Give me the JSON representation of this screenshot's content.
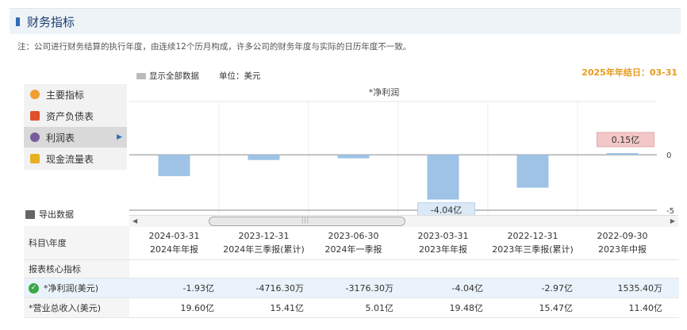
{
  "page": {
    "title": "财务指标",
    "note": "注：公司进行财务结算的执行年度，由连续12个历月构成，许多公司的财务年度与实际的日历年度不一致。",
    "fiscal_year_end": "2025年年结日：03-31",
    "show_all_label": "显示全部数据",
    "unit_label": "单位：美元",
    "export_label": "导出数据"
  },
  "nav": {
    "items": [
      {
        "label": "主要指标",
        "icon": "main-indicator-icon",
        "color": "#f0a030"
      },
      {
        "label": "资产负债表",
        "icon": "balance-sheet-icon",
        "color": "#e0502a"
      },
      {
        "label": "利润表",
        "icon": "income-statement-icon",
        "color": "#7a5c9c"
      },
      {
        "label": "现金流量表",
        "icon": "cash-flow-icon",
        "color": "#e8b020"
      }
    ],
    "active_index": 2
  },
  "chart_data": {
    "type": "bar",
    "title": "*净利润",
    "unit": "亿",
    "categories": [
      "2024-03-31",
      "2023-12-31",
      "2023-06-30",
      "2023-03-31",
      "2022-12-31",
      "2022-09-30"
    ],
    "values": [
      -1.93,
      -0.47163,
      -0.31763,
      -4.04,
      -2.97,
      0.15354
    ],
    "ylim": [
      -5.5,
      4.8
    ],
    "yticks": [
      "0",
      "-5"
    ],
    "bar_color": "#9ec3e6",
    "annotations": [
      {
        "category": "2023-03-31",
        "label": "-4.04亿"
      },
      {
        "category": "2022-09-30",
        "label": "0.15亿"
      }
    ],
    "grid": true
  },
  "table": {
    "corner_label": "科目\\年度",
    "columns": [
      {
        "date": "2024-03-31",
        "period": "2024年年报"
      },
      {
        "date": "2023-12-31",
        "period": "2024年三季报(累计)"
      },
      {
        "date": "2023-06-30",
        "period": "2024年一季报"
      },
      {
        "date": "2023-03-31",
        "period": "2023年年报"
      },
      {
        "date": "2022-12-31",
        "period": "2023年三季报(累计)"
      },
      {
        "date": "2022-09-30",
        "period": "2023年中报"
      }
    ],
    "section_label": "报表核心指标",
    "rows": [
      {
        "label": "*净利润(美元)",
        "checked": true,
        "values": [
          "-1.93亿",
          "-4716.30万",
          "-3176.30万",
          "-4.04亿",
          "-2.97亿",
          "1535.40万"
        ]
      },
      {
        "label": "*营业总收入(美元)",
        "checked": false,
        "values": [
          "19.60亿",
          "15.41亿",
          "5.01亿",
          "19.48亿",
          "15.47亿",
          "11.40亿"
        ]
      }
    ]
  }
}
